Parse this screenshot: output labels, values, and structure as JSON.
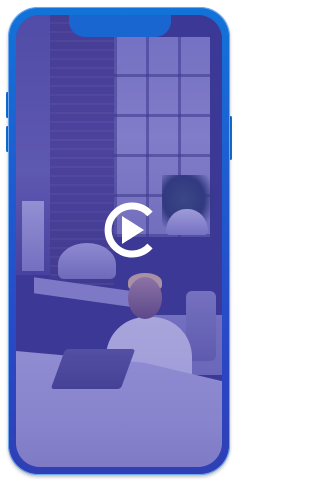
{
  "screen": {
    "overlay_color": "#3c37a5",
    "frame_color": "#1f5ad0",
    "play_icon_color": "#ffffff"
  },
  "icons": {
    "play": "play-icon",
    "brand": "c-logo-ring"
  }
}
